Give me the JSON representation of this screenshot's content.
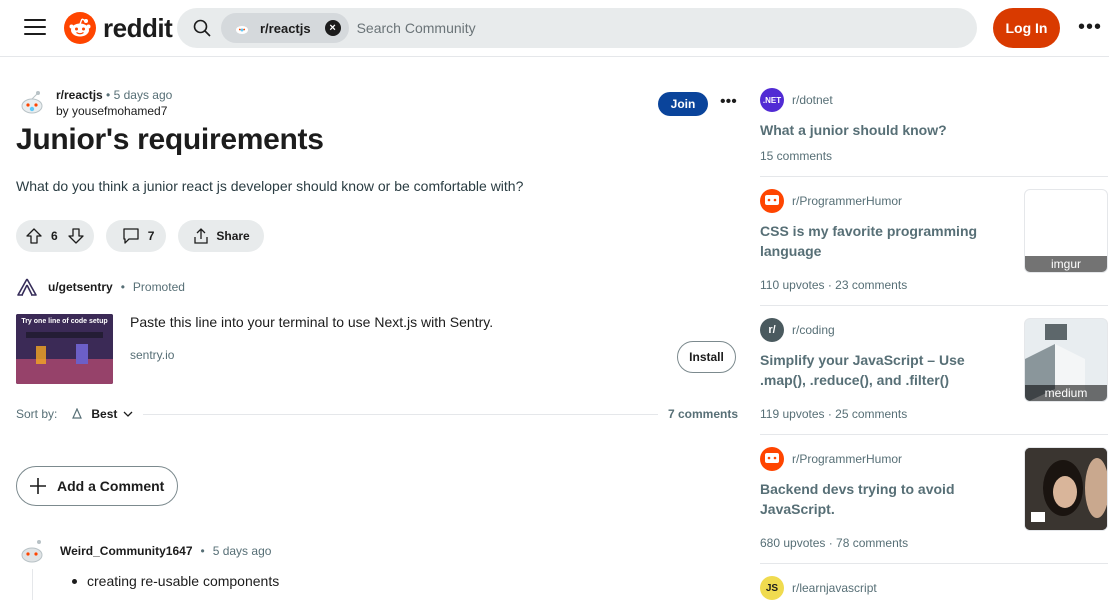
{
  "header": {
    "logo_text": "reddit",
    "search_chip": "r/reactjs",
    "search_placeholder": "Search Community",
    "login_label": "Log In",
    "more_label": "•••"
  },
  "post": {
    "subreddit": "r/reactjs",
    "age": "• 5 days ago",
    "author": "by yousefmohamed7",
    "join_label": "Join",
    "more_label": "•••",
    "title": "Junior's requirements",
    "body": "What do you think a junior react js developer should know or be comfortable with?",
    "upvotes": "6",
    "comments": "7",
    "share_label": "Share"
  },
  "promo": {
    "user": "u/getsentry",
    "dot": "•",
    "tag": "Promoted",
    "headline": "Paste this line into your terminal to use Next.js with Sentry.",
    "domain": "sentry.io",
    "install_label": "Install",
    "thumb_text": "Try one line of code setup"
  },
  "sort": {
    "label": "Sort by:",
    "value": "Best",
    "count": "7 comments"
  },
  "add_comment_label": "Add a Comment",
  "comment": {
    "author": "Weird_Community1647",
    "dot": "•",
    "age": "5 days ago",
    "text": "creating re-usable components"
  },
  "sidebar": {
    "cards": [
      {
        "sub": "r/dotnet",
        "icon_text": ".NET",
        "icon_color": "#512bd4",
        "title": "What a junior should know?",
        "stats": "15 comments",
        "thumb": ""
      },
      {
        "sub": "r/ProgrammerHumor",
        "icon_text": "",
        "icon_color": "#ff4500",
        "title": "CSS is my favorite programming language",
        "stats": "110 upvotes · 23 comments",
        "thumb": "imgur"
      },
      {
        "sub": "r/coding",
        "icon_text": "r/",
        "icon_color": "#4a5a5f",
        "title": "Simplify your JavaScript – Use .map(), .reduce(), and .filter()",
        "stats": "119 upvotes · 25 comments",
        "thumb": "medium"
      },
      {
        "sub": "r/ProgrammerHumor",
        "icon_text": "",
        "icon_color": "#ff4500",
        "title": "Backend devs trying to avoid JavaScript.",
        "stats": "680 upvotes · 78 comments",
        "thumb": ""
      },
      {
        "sub": "r/learnjavascript",
        "icon_text": "JS",
        "icon_color": "#f0db4f"
      }
    ]
  }
}
